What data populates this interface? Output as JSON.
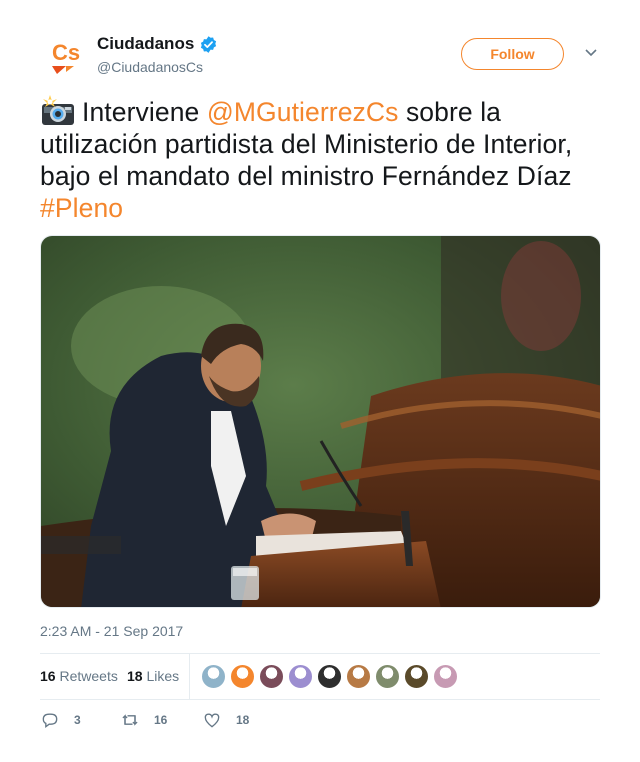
{
  "account": {
    "name": "Ciudadanos",
    "handle": "@CiudadanosCs",
    "logo_text": "Cs"
  },
  "follow_label": "Follow",
  "tweet": {
    "pre": "Interviene ",
    "mention": "@MGutierrezCs",
    "body": " sobre la utilización partidista del Ministerio de Interior, bajo el mandato del ministro Fernández Díaz ",
    "hashtag": "#Pleno"
  },
  "timestamp": "2:23 AM - 21 Sep 2017",
  "stats": {
    "retweets_count": "16",
    "retweets_label": "Retweets",
    "likes_count": "18",
    "likes_label": "Likes"
  },
  "liker_avatars": [
    "#8fb3c9",
    "#f4862d",
    "#7a4c5a",
    "#9c8ed0",
    "#2e2e2e",
    "#b77a45",
    "#7f8c6c",
    "#5a4a2a",
    "#c79ab3"
  ],
  "actions": {
    "reply_count": "3",
    "retweet_count": "16",
    "like_count": "18"
  },
  "colors": {
    "accent": "#f4862d",
    "verified": "#1da1f2",
    "muted": "#657786"
  }
}
